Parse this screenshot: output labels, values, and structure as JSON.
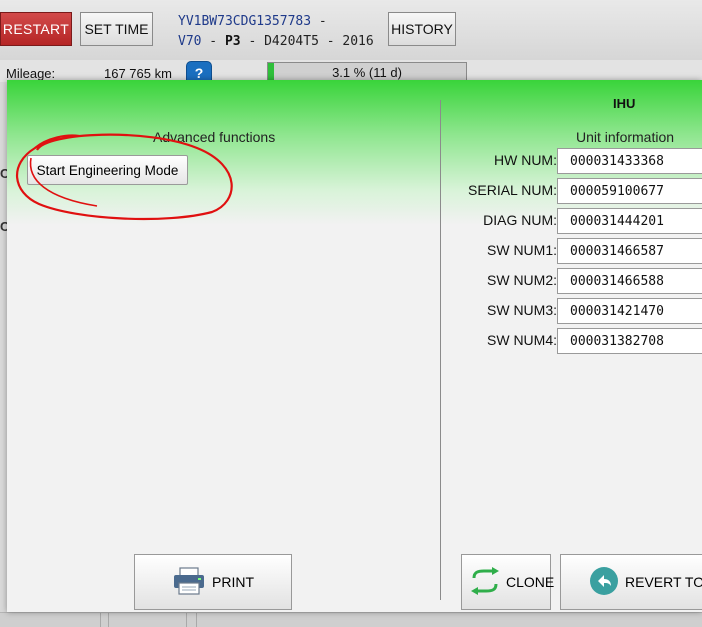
{
  "toolbar": {
    "restart_label": "RESTART",
    "set_time_label": "SET TIME",
    "history_label": "HISTORY"
  },
  "vehicle": {
    "vin": "YV1BW73CDG1357783",
    "model": "V70",
    "platform": "P3",
    "engine": "D4204T5",
    "year": "2016",
    "separator": " - "
  },
  "status": {
    "mileage_label": "Mileage:",
    "mileage_value": "167 765 km",
    "info_glyph": "?",
    "progress_text": "3.1 % (11 d)",
    "progress_value": 3.1
  },
  "background_letters": [
    "C",
    "C"
  ],
  "dialog": {
    "advanced_title": "Advanced functions",
    "engineering_button": "Start Engineering Mode",
    "unit_title": "IHU",
    "unit_subtitle": "Unit information",
    "fields": [
      {
        "label": "HW NUM:",
        "value": "000031433368"
      },
      {
        "label": "SERIAL NUM:",
        "value": "000059100677"
      },
      {
        "label": "DIAG NUM:",
        "value": "000031444201"
      },
      {
        "label": "SW NUM1:",
        "value": "000031466587"
      },
      {
        "label": "SW NUM2:",
        "value": "000031466588"
      },
      {
        "label": "SW NUM3:",
        "value": "000031421470"
      },
      {
        "label": "SW NUM4:",
        "value": "000031382708"
      }
    ],
    "print_label": "PRINT",
    "clone_label": "CLONE",
    "revert_label": "REVERT TO O"
  },
  "icons": {
    "printer": "printer-icon",
    "clone": "clone-arrows-icon",
    "revert": "revert-arrow-icon",
    "info": "info-icon"
  },
  "colors": {
    "restart_red": "#c23333",
    "dialog_header_green": "#39d43a",
    "vin_blue": "#1f3a8a",
    "annotation_red": "#e01010",
    "progress_green": "#2fbf3a",
    "clone_green": "#2fae4a",
    "revert_teal": "#3aa0a0"
  }
}
